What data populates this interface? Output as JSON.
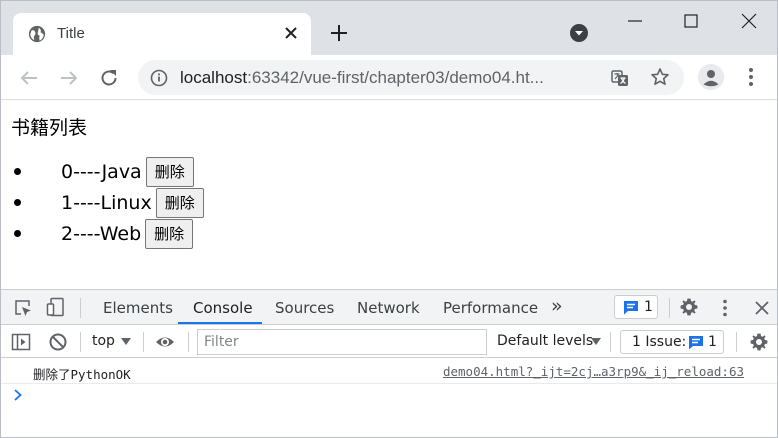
{
  "browser": {
    "tab_title": "Title",
    "url_host": "localhost",
    "url_rest": ":63342/vue-first/chapter03/demo04.ht...",
    "icons": [
      "globe-icon",
      "close-icon",
      "plus-icon",
      "tab-search-icon",
      "minimize-icon",
      "maximize-icon",
      "close-window-icon",
      "back-icon",
      "forward-icon",
      "reload-icon",
      "info-icon",
      "translate-icon",
      "star-icon",
      "profile-icon",
      "more-vert-icon"
    ]
  },
  "page": {
    "heading": "书籍列表",
    "books": [
      {
        "text": "0----Java",
        "delete_label": "删除"
      },
      {
        "text": "1----Linux",
        "delete_label": "删除"
      },
      {
        "text": "2----Web",
        "delete_label": "删除"
      }
    ]
  },
  "devtools": {
    "tabs": [
      "Elements",
      "Console",
      "Sources",
      "Network",
      "Performance"
    ],
    "active_tab": "Console",
    "overflow_label": "»",
    "message_count": "1",
    "context": "top",
    "filter_placeholder": "Filter",
    "levels_label": "Default levels",
    "issues_label": "1 Issue:",
    "issues_count": "1",
    "console_message": "删除了PythonOK",
    "console_source": "demo04.html?_ijt=2cj…a3rp9&_ij_reload:63",
    "colors": {
      "accent": "#1a73e8",
      "icon": "#5f6368"
    }
  }
}
